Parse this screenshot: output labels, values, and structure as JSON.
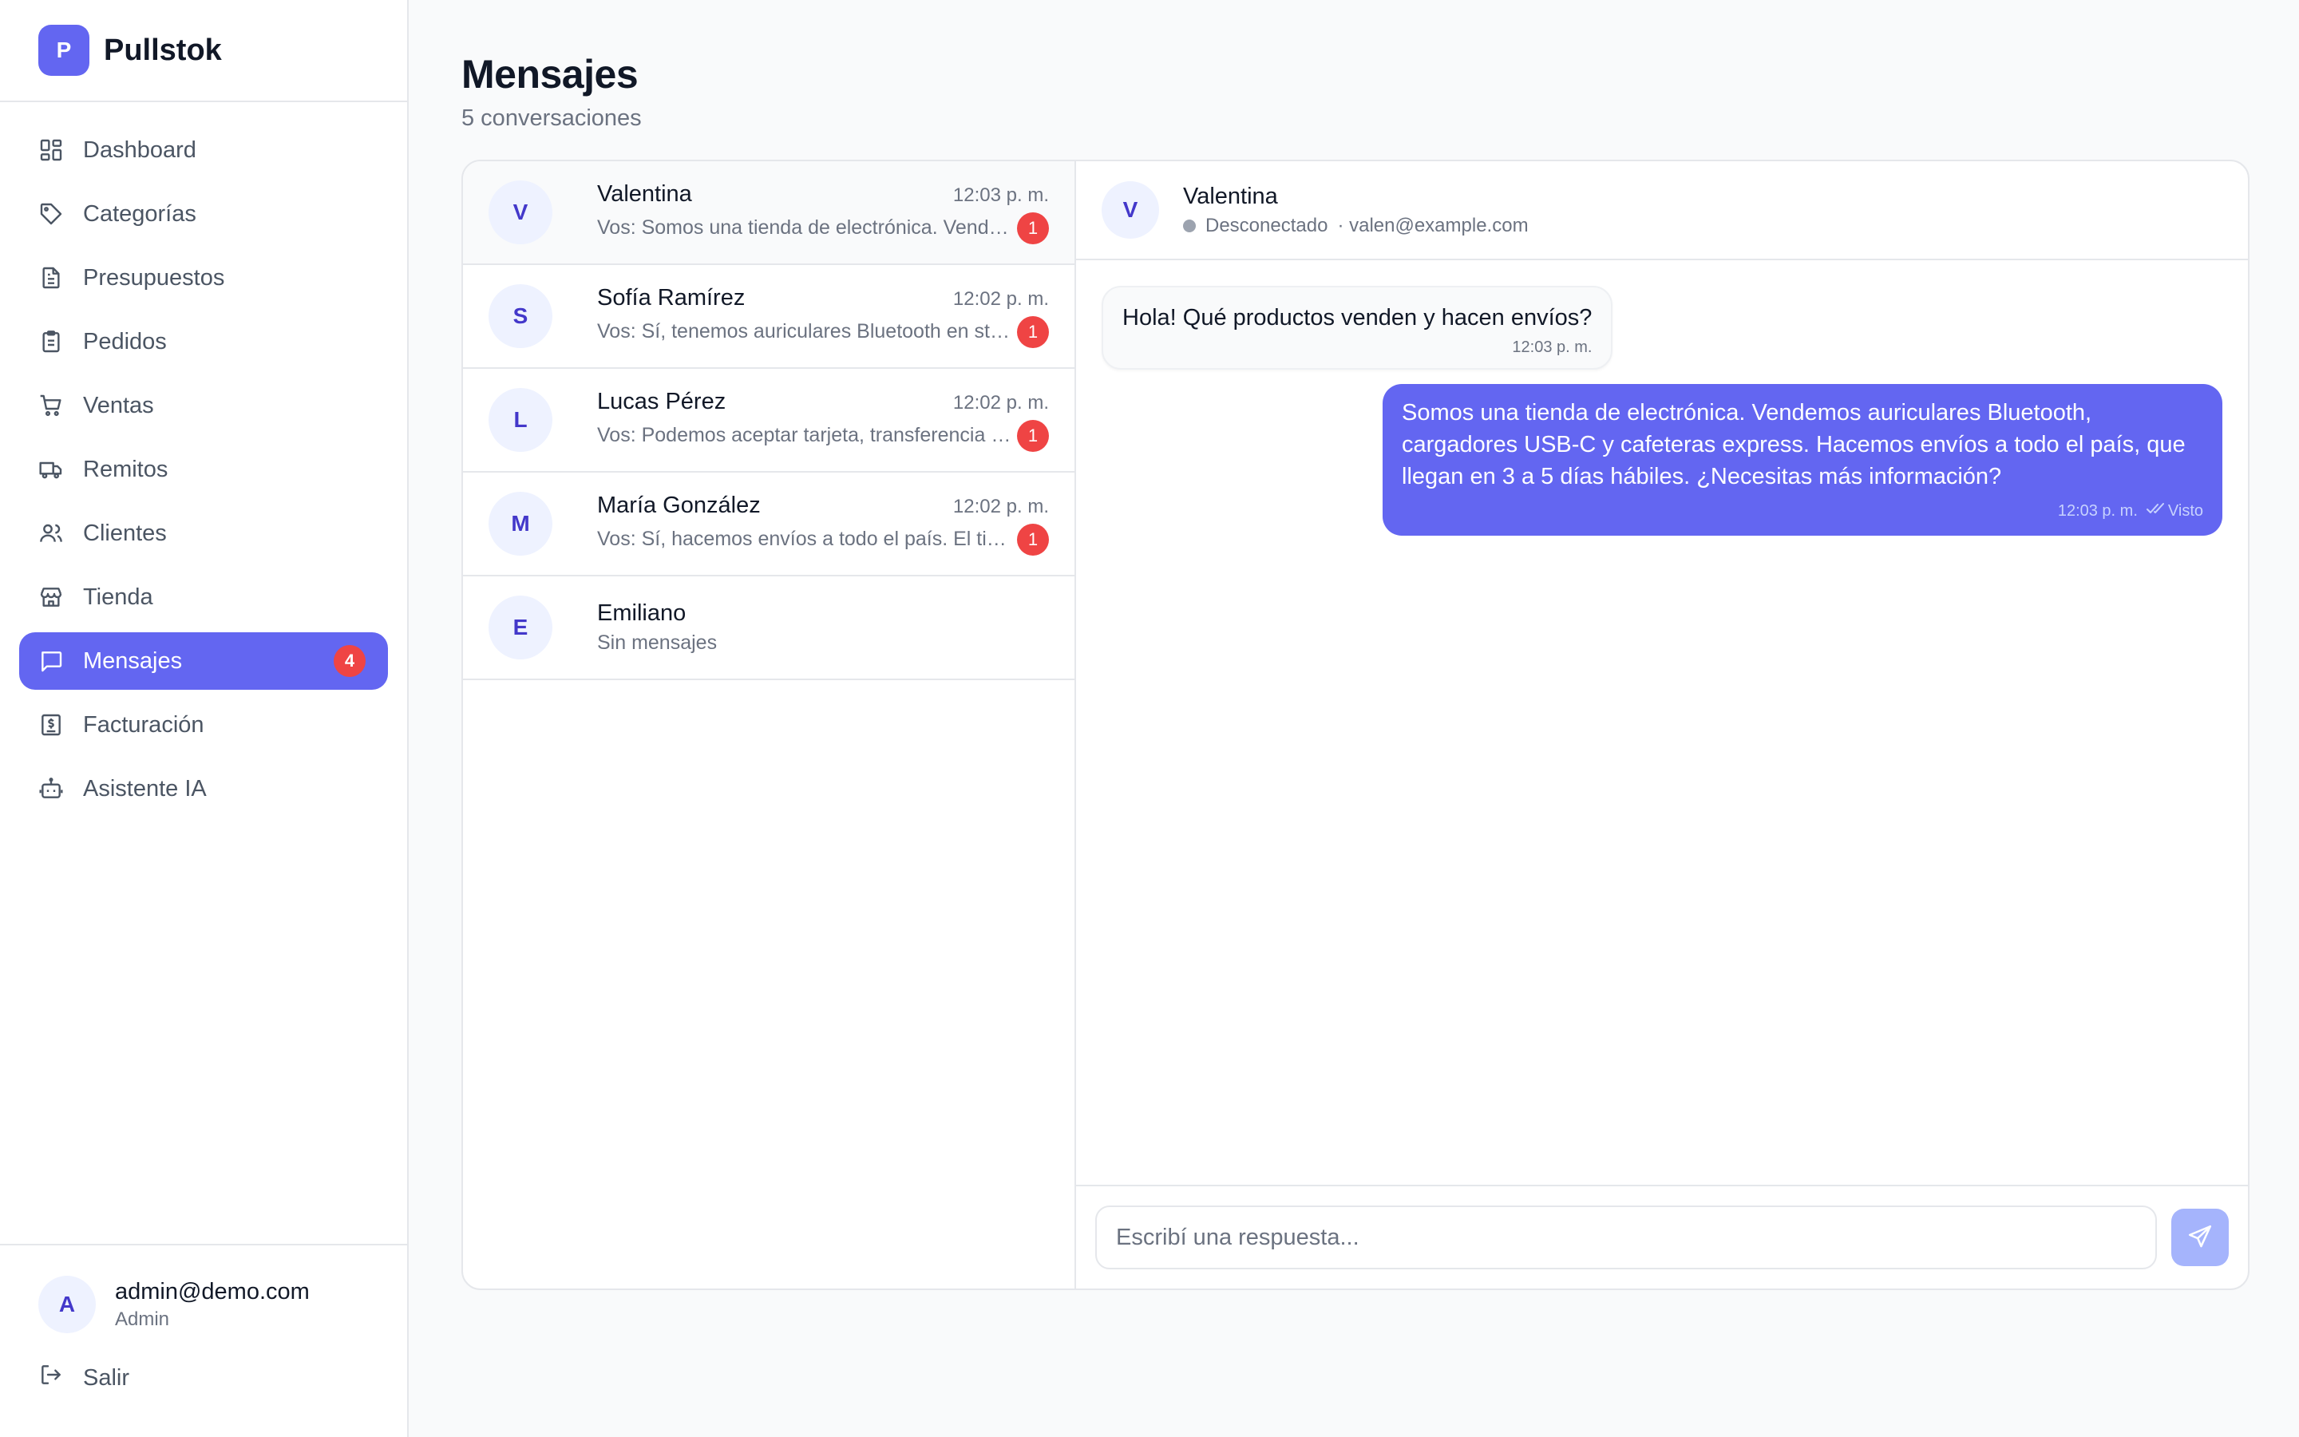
{
  "brand": {
    "logo_letter": "P",
    "name": "Pullstok"
  },
  "nav": {
    "items": [
      {
        "label": "Dashboard",
        "icon": "dashboard-icon"
      },
      {
        "label": "Categorías",
        "icon": "tag-icon"
      },
      {
        "label": "Presupuestos",
        "icon": "document-icon"
      },
      {
        "label": "Pedidos",
        "icon": "clipboard-icon"
      },
      {
        "label": "Ventas",
        "icon": "cart-icon"
      },
      {
        "label": "Remitos",
        "icon": "truck-icon"
      },
      {
        "label": "Clientes",
        "icon": "users-icon"
      },
      {
        "label": "Tienda",
        "icon": "store-icon"
      },
      {
        "label": "Mensajes",
        "icon": "message-icon",
        "badge": "4",
        "active": true
      },
      {
        "label": "Facturación",
        "icon": "invoice-icon"
      },
      {
        "label": "Asistente IA",
        "icon": "bot-icon"
      }
    ]
  },
  "user": {
    "avatar_letter": "A",
    "email": "admin@demo.com",
    "role": "Admin"
  },
  "logout_label": "Salir",
  "page": {
    "title": "Mensajes",
    "subtitle": "5 conversaciones"
  },
  "conversations": [
    {
      "avatar": "V",
      "name": "Valentina",
      "time": "12:03 p. m.",
      "preview": "Vos: Somos una tienda de electrónica. Vendemos auriculares Bluetooth, cargadores USB-C y cafeteras express.",
      "unread": "1",
      "selected": true
    },
    {
      "avatar": "S",
      "name": "Sofía Ramírez",
      "time": "12:02 p. m.",
      "preview": "Vos: Sí, tenemos auriculares Bluetooth en stock.",
      "unread": "1"
    },
    {
      "avatar": "L",
      "name": "Lucas Pérez",
      "time": "12:02 p. m.",
      "preview": "Vos: Podemos aceptar tarjeta, transferencia y efectivo.",
      "unread": "1"
    },
    {
      "avatar": "M",
      "name": "María González",
      "time": "12:02 p. m.",
      "preview": "Vos: Sí, hacemos envíos a todo el país. El tiempo de entrega es de 3 a 5 días.",
      "unread": "1"
    },
    {
      "avatar": "E",
      "name": "Emiliano",
      "time": "",
      "preview": "Sin mensajes",
      "unread": ""
    }
  ],
  "chat": {
    "avatar": "V",
    "name": "Valentina",
    "status": "Desconectado",
    "email": "· valen@example.com",
    "messages": [
      {
        "direction": "in",
        "text": "Hola! Qué productos venden y hacen envíos?",
        "time": "12:03 p. m."
      },
      {
        "direction": "out",
        "text": "Somos una tienda de electrónica. Vendemos auriculares Bluetooth, cargadores USB-C y cafeteras express. Hacemos envíos a todo el país, que llegan en 3 a 5 días hábiles. ¿Necesitas más información?",
        "time": "12:03 p. m.",
        "seen": "Visto"
      }
    ],
    "composer_placeholder": "Escribí una respuesta..."
  },
  "colors": {
    "accent": "#6366f1",
    "badge": "#ef4444",
    "avatar_bg": "#eef2ff",
    "avatar_text": "#4338ca"
  }
}
